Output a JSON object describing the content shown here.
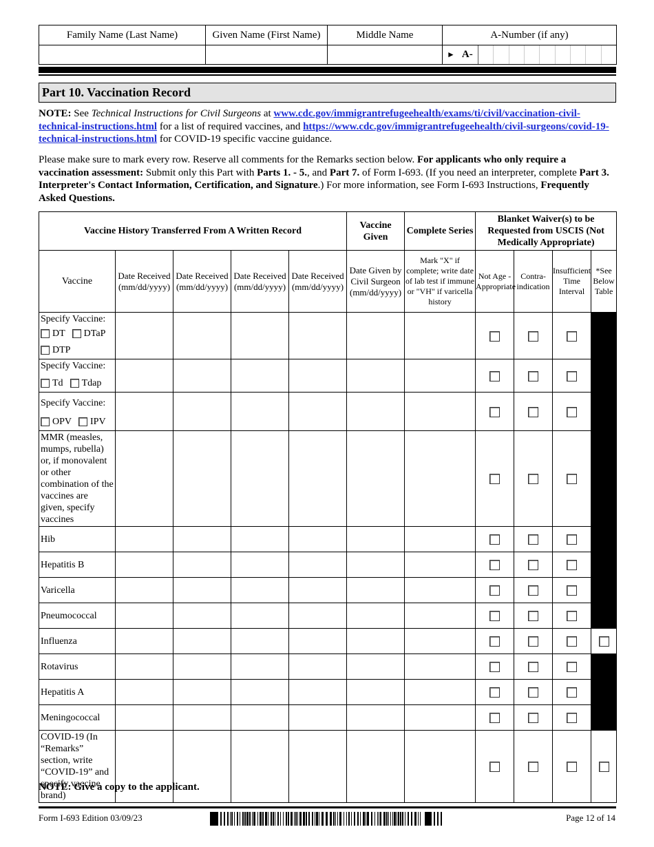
{
  "header": {
    "columns": [
      "Family Name (Last Name)",
      "Given Name (First Name)",
      "Middle Name",
      "A-Number (if any)"
    ],
    "a_number_prefix": "A-",
    "a_number_arrow": "►",
    "values": {
      "family_name": "",
      "given_name": "",
      "middle_name": "",
      "a_number": ""
    }
  },
  "part": {
    "title": "Part 10.  Vaccination Record"
  },
  "note1": {
    "label": "NOTE:",
    "text_a": "  See ",
    "italic": "Technical Instructions for Civil Surgeons",
    "text_b": " at ",
    "link1": "www.cdc.gov/immigrantrefugeehealth/exams/ti/civil/vaccination-civil-technical-instructions.html",
    "text_c": " for a list of required vaccines, and ",
    "link2": "https://www.cdc.gov/immigrantrefugeehealth/civil-surgeons/covid-19-technical-instructions.html",
    "text_d": " for COVID-19 specific vaccine guidance."
  },
  "note2": {
    "t1": "Please make sure to mark every row.  Reserve all comments for the Remarks section below.  ",
    "b1": "For applicants who only require a vaccination assessment:",
    "t2": "  Submit only this Part with ",
    "b2": "Parts 1. - 5.",
    "t3": ", and ",
    "b3": "Part 7.",
    "t4": " of Form I-693.  (If you need an interpreter, complete ",
    "b4": "Part 3. Interpreter's Contact Information, Certification, and Signature",
    "t5": ".)  For more information, see Form I-693 Instructions, ",
    "b5": "Frequently Asked Questions."
  },
  "table": {
    "group_headers": {
      "history": "Vaccine History Transferred From A Written Record",
      "given": "Vaccine Given",
      "complete": "Complete Series",
      "waiver": "Blanket Waiver(s) to be Requested from USCIS (Not Medically Appropriate)"
    },
    "sub_headers": {
      "vaccine": "Vaccine",
      "date_received": "Date Received (mm/dd/yyyy)",
      "date_given": "Date Given by Civil Surgeon (mm/dd/yyyy)",
      "complete_series": "Mark \"X\" if complete; write date of lab test if immune or \"VH\" if varicella history",
      "not_age": "Not Age - Appropriate",
      "contra": "Contra-indication",
      "insufficient": "Insufficient Time Interval",
      "see_below": "*See Below Table"
    },
    "rows": [
      {
        "vaccine": "Specify Vaccine:",
        "options": [
          "DT",
          "DTaP",
          "DTP"
        ],
        "see_below_checkbox": false
      },
      {
        "vaccine": "Specify Vaccine:",
        "options": [
          "Td",
          "Tdap"
        ],
        "see_below_checkbox": false
      },
      {
        "vaccine": "Specify Vaccine:",
        "options": [
          "OPV",
          "IPV"
        ],
        "see_below_checkbox": false
      },
      {
        "vaccine": "MMR (measles, mumps, rubella) or, if monovalent or other combination of the vaccines are given, specify vaccines",
        "options": [],
        "see_below_checkbox": false
      },
      {
        "vaccine": "Hib",
        "options": [],
        "see_below_checkbox": false
      },
      {
        "vaccine": "Hepatitis B",
        "options": [],
        "see_below_checkbox": false
      },
      {
        "vaccine": "Varicella",
        "options": [],
        "see_below_checkbox": false
      },
      {
        "vaccine": "Pneumococcal",
        "options": [],
        "see_below_checkbox": false
      },
      {
        "vaccine": "Influenza",
        "options": [],
        "see_below_checkbox": true
      },
      {
        "vaccine": "Rotavirus",
        "options": [],
        "see_below_checkbox": false
      },
      {
        "vaccine": "Hepatitis A",
        "options": [],
        "see_below_checkbox": false
      },
      {
        "vaccine": "Meningococcal",
        "options": [],
        "see_below_checkbox": false
      },
      {
        "vaccine": "COVID-19 (In “Remarks” section, write “COVID-19” and specify vaccine brand)",
        "options": [],
        "see_below_checkbox": true
      }
    ]
  },
  "note_bottom": "NOTE:  Give a copy to the applicant.",
  "footer": {
    "form_info": "Form I-693   Edition   03/09/23",
    "page": "Page 12 of 14"
  }
}
